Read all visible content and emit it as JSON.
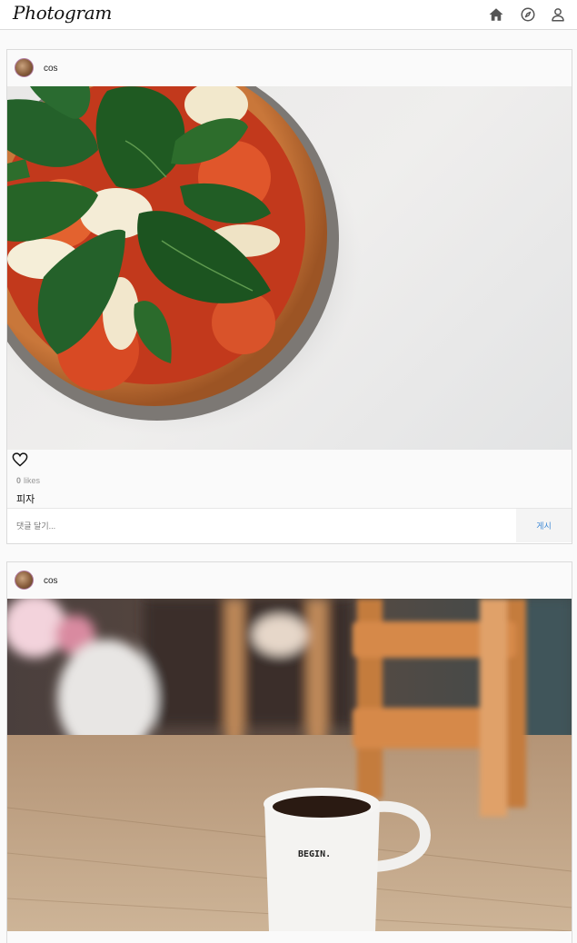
{
  "header": {
    "logo": "Photogram",
    "nav": [
      {
        "name": "home-icon"
      },
      {
        "name": "compass-icon"
      },
      {
        "name": "user-icon"
      }
    ]
  },
  "posts": [
    {
      "username": "cos",
      "image": "pizza",
      "likes_count": "0",
      "likes_label": "likes",
      "caption": "피자",
      "comment_placeholder": "댓글 달기...",
      "post_label": "게시"
    },
    {
      "username": "cos",
      "image": "coffee-mug",
      "mug_text": "BEGIN."
    }
  ],
  "colors": {
    "accent": "#3f8ad6",
    "border": "#dbdbdb",
    "background": "#fafafa"
  }
}
